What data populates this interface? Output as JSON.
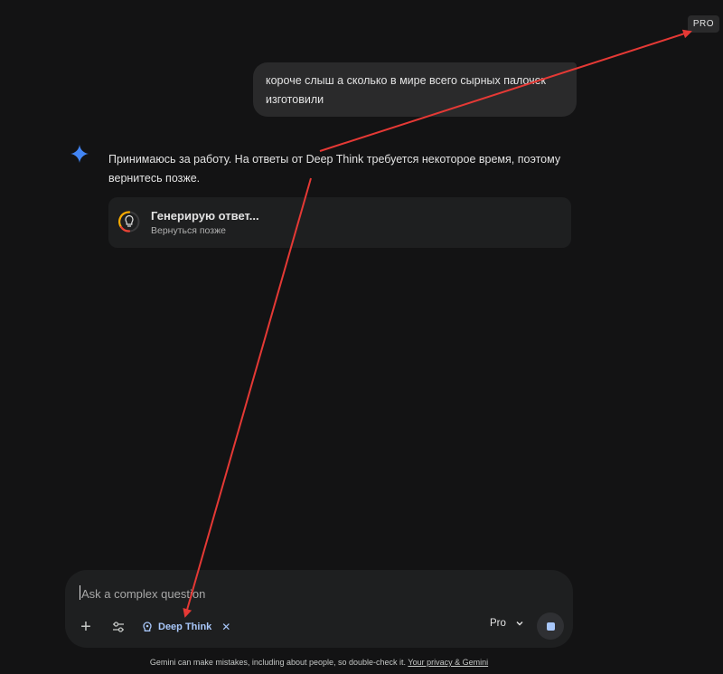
{
  "badge": {
    "label": "PRO"
  },
  "conversation": {
    "user_message": "короче слыш а сколько в мире всего сырных палочек изготовили",
    "model_message": "Принимаюсь за работу. На ответы от Deep Think требуется некоторое время, поэтому вернитесь позже.",
    "status_card": {
      "title": "Генерирую ответ...",
      "subtitle": "Вернуться позже"
    }
  },
  "composer": {
    "placeholder": "Ask a complex question",
    "plus_icon": "plus-icon",
    "tools_icon": "tune-icon",
    "tool_chip": {
      "label": "Deep Think",
      "icon": "deep-think-icon",
      "close_label": "✕"
    },
    "model_selector": {
      "label": "Pro",
      "icon": "chevron-down-icon"
    },
    "stop_icon": "stop-icon"
  },
  "footer": {
    "disclaimer": "Gemini can make mistakes, including about people, so double-check it.",
    "privacy_link": "Your privacy & Gemini"
  },
  "colors": {
    "background": "#131314",
    "bubble": "#2a2a2b",
    "accent": "#a8c7fa",
    "annotation_arrow": "#e53935",
    "sparkle": "#4285f4"
  }
}
